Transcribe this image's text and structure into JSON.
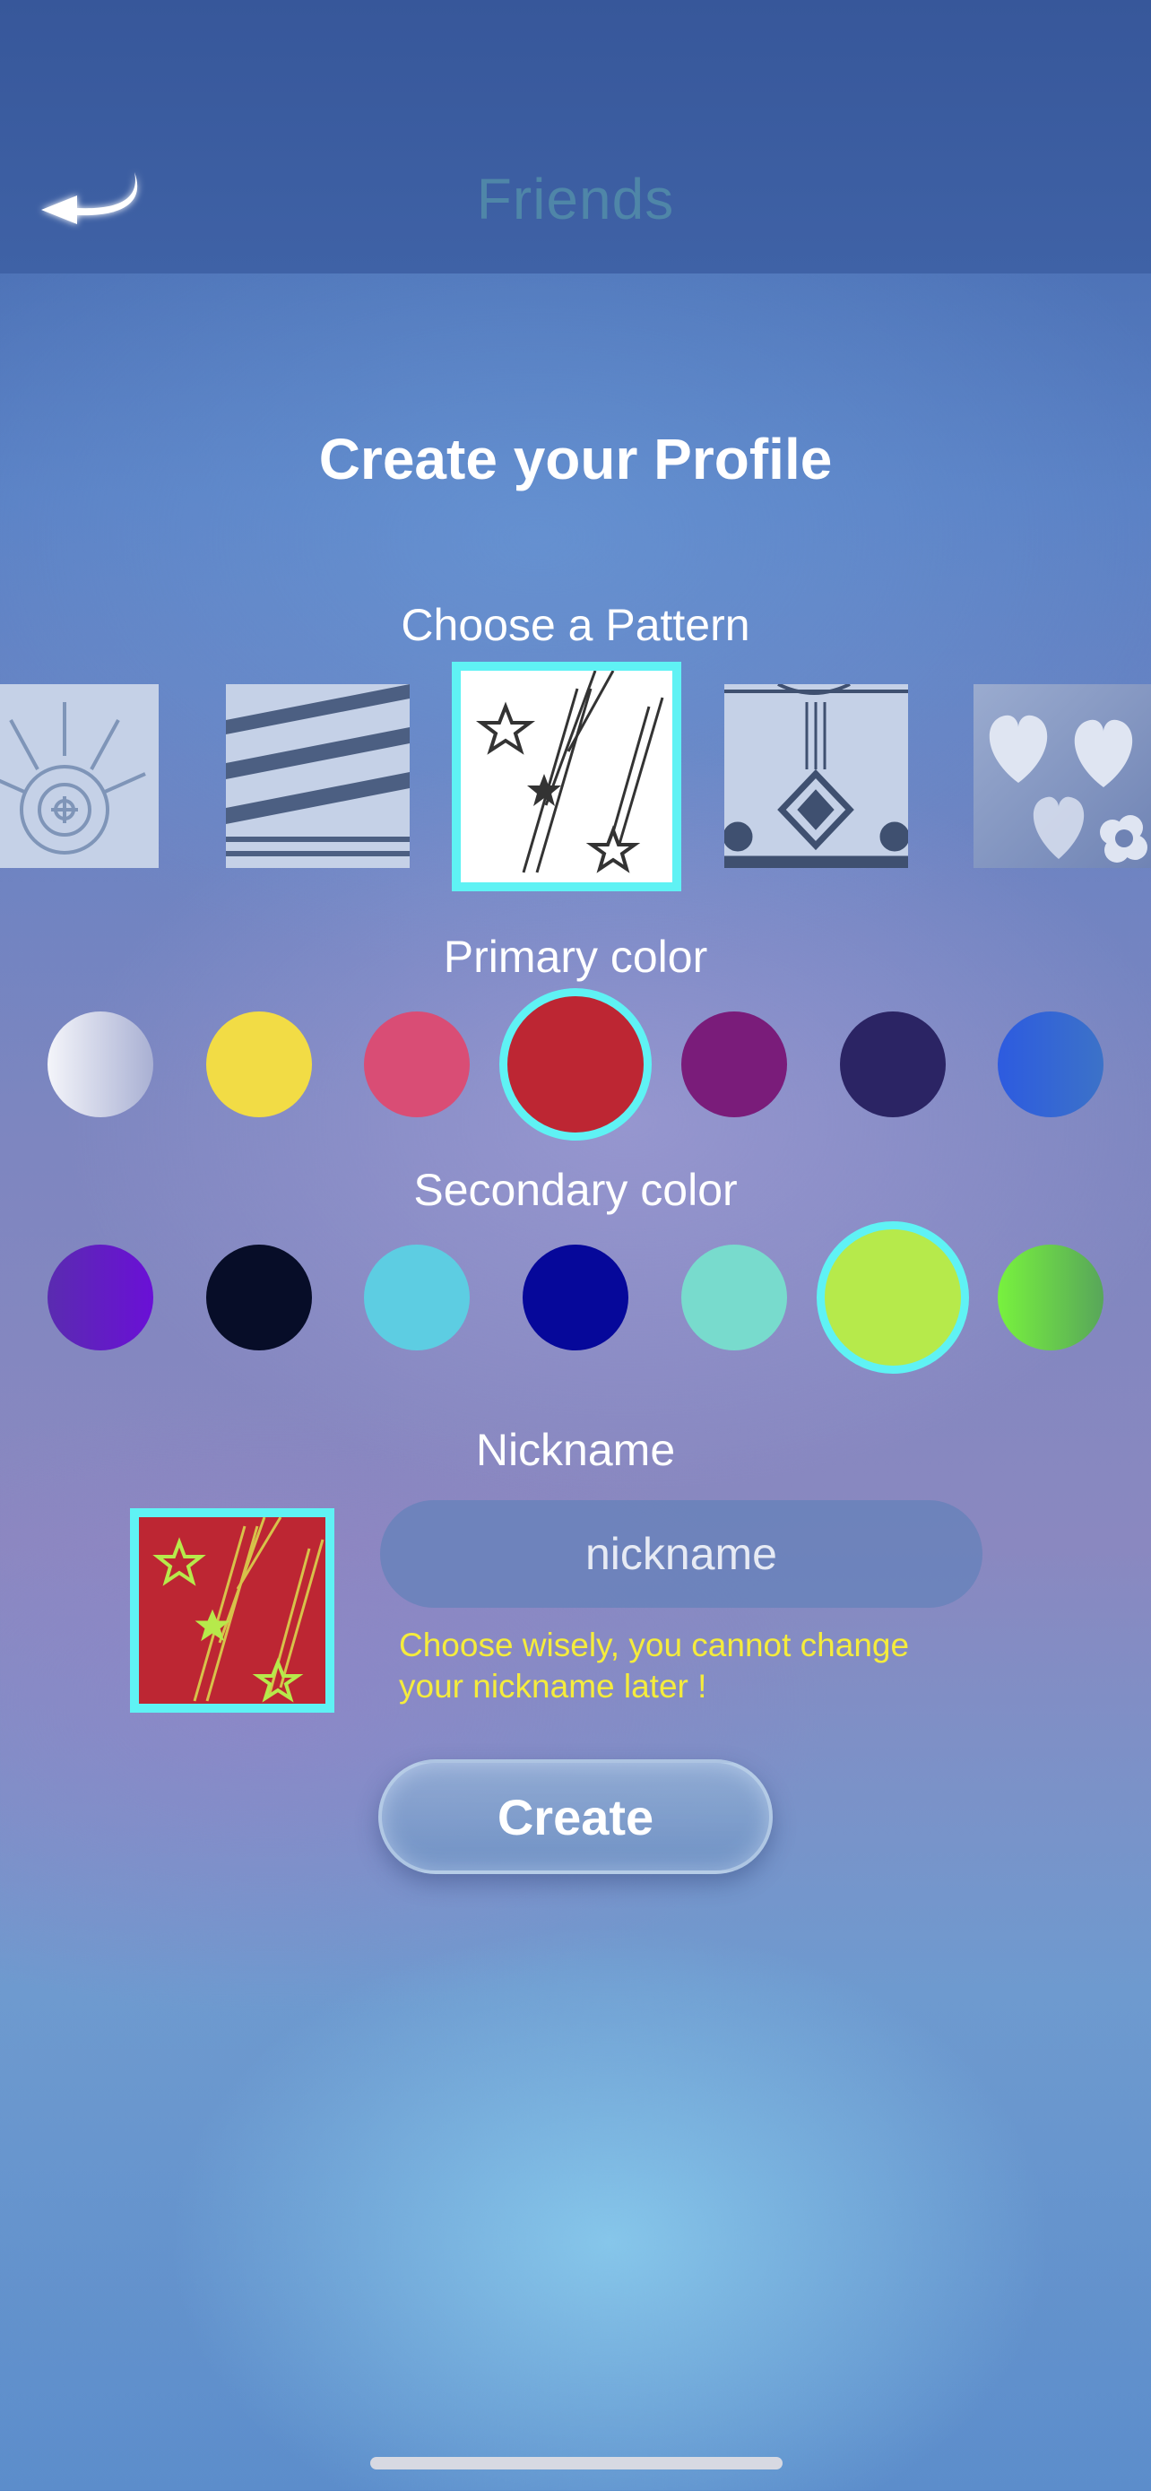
{
  "header": {
    "title": "Friends",
    "back_icon": "back-arrow-icon"
  },
  "page_title": "Create your Profile",
  "pattern_section": {
    "label": "Choose a Pattern",
    "patterns": [
      "sun-burst",
      "diagonal-stripes",
      "shooting-stars",
      "ornament",
      "hearts-flowers"
    ],
    "selected": "shooting-stars"
  },
  "primary_section": {
    "label": "Primary color",
    "colors": [
      "#e4e6f2",
      "#f2dc45",
      "#d94d75",
      "#bd2633",
      "#7a1c7a",
      "#2b2464",
      "#2f62d6"
    ],
    "selected": "#bd2633"
  },
  "secondary_section": {
    "label": "Secondary color",
    "colors": [
      "#6a1fc7",
      "#070d28",
      "#5dcde2",
      "#06089a",
      "#78dbcd",
      "#b6ea4b",
      "#6ddc4a"
    ],
    "selected": "#b6ea4b"
  },
  "nickname_section": {
    "label": "Nickname",
    "placeholder": "nickname",
    "value": "",
    "warning": "Choose wisely, you cannot change your nickname later !"
  },
  "create_button": {
    "label": "Create"
  },
  "colors": {
    "accent": "#5ff2f4",
    "warning": "#f5ec3c"
  }
}
